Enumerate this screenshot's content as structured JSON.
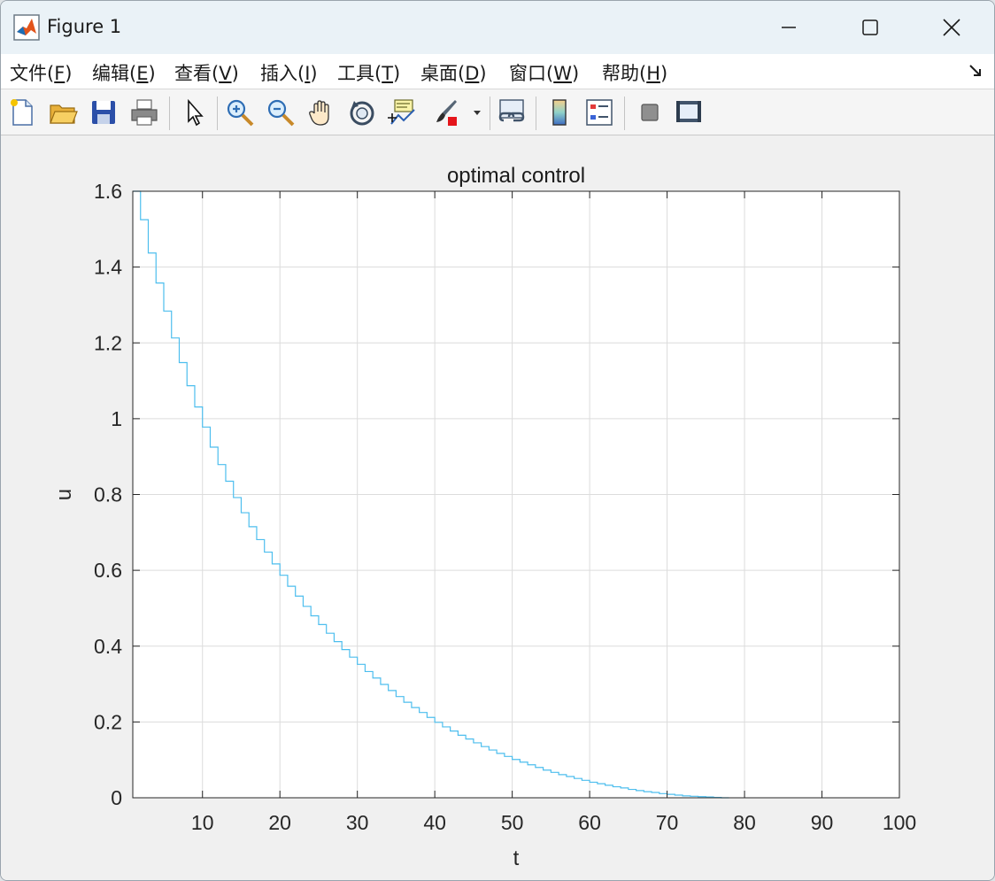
{
  "window": {
    "title": "Figure 1",
    "app_icon": "matlab-logo-icon",
    "controls": [
      "minimize-icon",
      "maximize-icon",
      "close-icon"
    ]
  },
  "menu": {
    "items": [
      {
        "label": "文件(",
        "key": "F",
        "tail": ")"
      },
      {
        "label": "编辑(",
        "key": "E",
        "tail": ")"
      },
      {
        "label": "查看(",
        "key": "V",
        "tail": ")"
      },
      {
        "label": "插入(",
        "key": "I",
        "tail": ")"
      },
      {
        "label": "工具(",
        "key": "T",
        "tail": ")"
      },
      {
        "label": "桌面(",
        "key": "D",
        "tail": ")"
      },
      {
        "label": "窗口(",
        "key": "W",
        "tail": ")"
      },
      {
        "label": "帮助(",
        "key": "H",
        "tail": ")"
      }
    ]
  },
  "toolbar": {
    "buttons": [
      "new-figure-icon",
      "open-file-icon",
      "save-icon",
      "print-icon",
      "select-arrow-icon",
      "zoom-in-icon",
      "zoom-out-icon",
      "pan-hand-icon",
      "rotate-3d-icon",
      "data-cursor-icon",
      "brush-icon",
      "brush-dropdown-icon",
      "link-plot-icon",
      "colorbar-icon",
      "legend-icon",
      "hide-plot-tools-icon",
      "show-plot-tools-icon"
    ]
  },
  "chart_data": {
    "type": "line",
    "title": "optimal control",
    "xlabel": "t",
    "ylabel": "u",
    "xlim": [
      1,
      100
    ],
    "ylim": [
      0,
      1.6
    ],
    "xticks": [
      10,
      20,
      30,
      40,
      50,
      60,
      70,
      80,
      90,
      100
    ],
    "yticks": [
      0,
      0.2,
      0.4,
      0.6,
      0.8,
      1,
      1.2,
      1.4,
      1.6
    ],
    "ytick_labels": [
      "0",
      "0.2",
      "0.4",
      "0.6",
      "0.8",
      "1",
      "1.2",
      "1.4",
      "1.6"
    ],
    "xtick_labels": [
      "10",
      "20",
      "30",
      "40",
      "50",
      "60",
      "70",
      "80",
      "90",
      "100"
    ],
    "grid": true,
    "series": [
      {
        "style": "stairs",
        "color": "#4dbeee",
        "x": [
          1,
          2,
          3,
          4,
          5,
          6,
          7,
          8,
          9,
          10,
          11,
          12,
          13,
          14,
          15,
          16,
          17,
          18,
          19,
          20,
          21,
          22,
          23,
          24,
          25,
          26,
          27,
          28,
          29,
          30,
          31,
          32,
          33,
          34,
          35,
          36,
          37,
          38,
          39,
          40,
          41,
          42,
          43,
          44,
          45,
          46,
          47,
          48,
          49,
          50,
          51,
          52,
          53,
          54,
          55,
          56,
          57,
          58,
          59,
          60,
          61,
          62,
          63,
          64,
          65,
          66,
          67,
          68,
          69,
          70,
          71,
          72,
          73,
          74,
          75,
          76,
          77,
          78
        ],
        "y": [
          1.6,
          1.525,
          1.437,
          1.358,
          1.284,
          1.213,
          1.148,
          1.087,
          1.031,
          0.978,
          0.925,
          0.879,
          0.835,
          0.792,
          0.752,
          0.715,
          0.681,
          0.648,
          0.617,
          0.587,
          0.558,
          0.532,
          0.505,
          0.48,
          0.457,
          0.434,
          0.412,
          0.391,
          0.371,
          0.352,
          0.333,
          0.316,
          0.299,
          0.283,
          0.267,
          0.252,
          0.238,
          0.225,
          0.212,
          0.199,
          0.187,
          0.176,
          0.165,
          0.155,
          0.145,
          0.135,
          0.126,
          0.117,
          0.109,
          0.101,
          0.094,
          0.087,
          0.08,
          0.073,
          0.067,
          0.061,
          0.056,
          0.051,
          0.046,
          0.041,
          0.037,
          0.033,
          0.029,
          0.026,
          0.022,
          0.019,
          0.016,
          0.014,
          0.011,
          0.009,
          0.007,
          0.005,
          0.004,
          0.003,
          0.002,
          0.001,
          0.0,
          0.0
        ]
      }
    ]
  }
}
